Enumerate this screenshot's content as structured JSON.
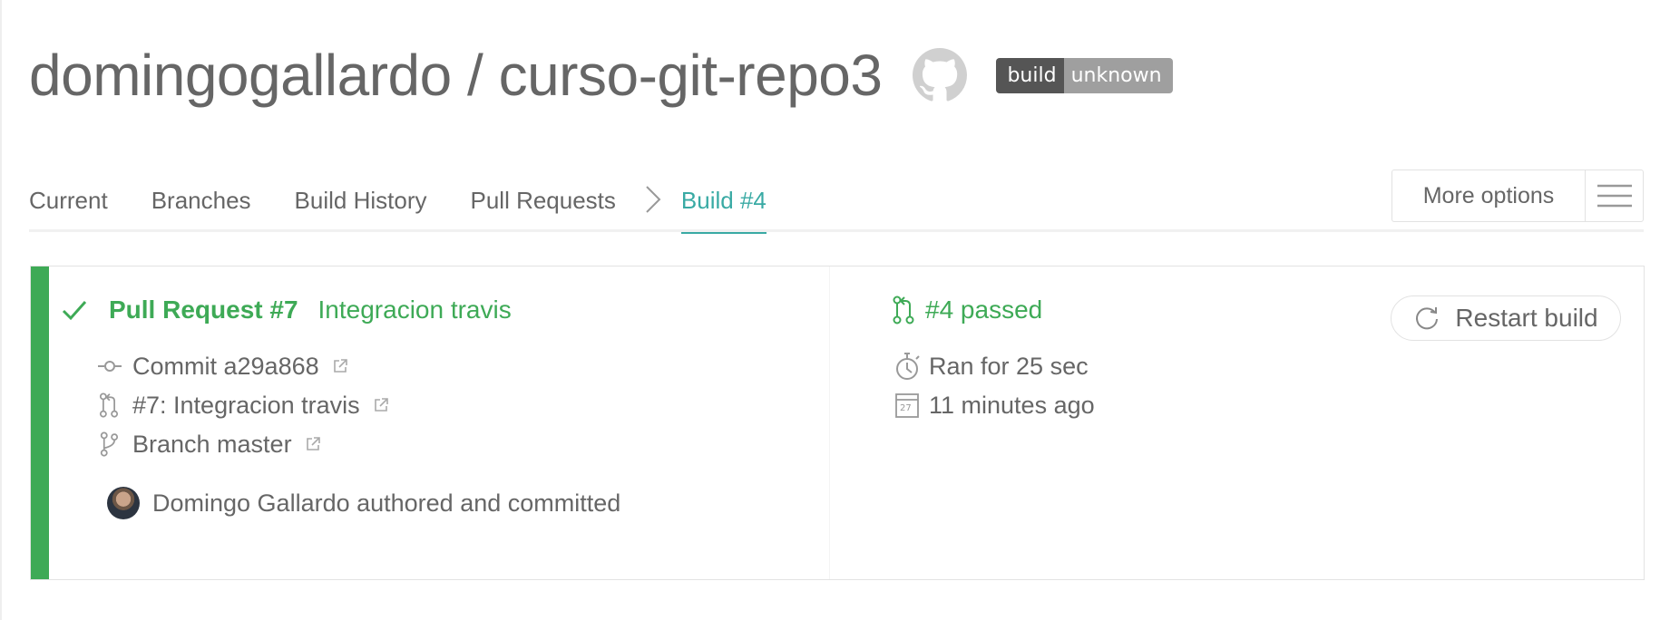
{
  "repo": {
    "title": "domingogallardo / curso-git-repo3",
    "badge_left": "build",
    "badge_right": "unknown"
  },
  "nav": {
    "tabs": [
      "Current",
      "Branches",
      "Build History",
      "Pull Requests"
    ],
    "active_tab": "Build #4",
    "more_options": "More options"
  },
  "build": {
    "pull_request": "Pull Request #7",
    "pr_title": "Integracion travis",
    "status": "#4 passed",
    "restart_label": "Restart build",
    "commit": "Commit a29a868",
    "pr_link": "#7: Integracion travis",
    "branch": "Branch master",
    "duration": "Ran for 25 sec",
    "calendar_day": "27",
    "finished": "11 minutes ago",
    "author": "Domingo Gallardo authored and committed"
  },
  "colors": {
    "passed": "#3eaa56",
    "active_tab": "#39aaa4",
    "text": "#666666"
  }
}
